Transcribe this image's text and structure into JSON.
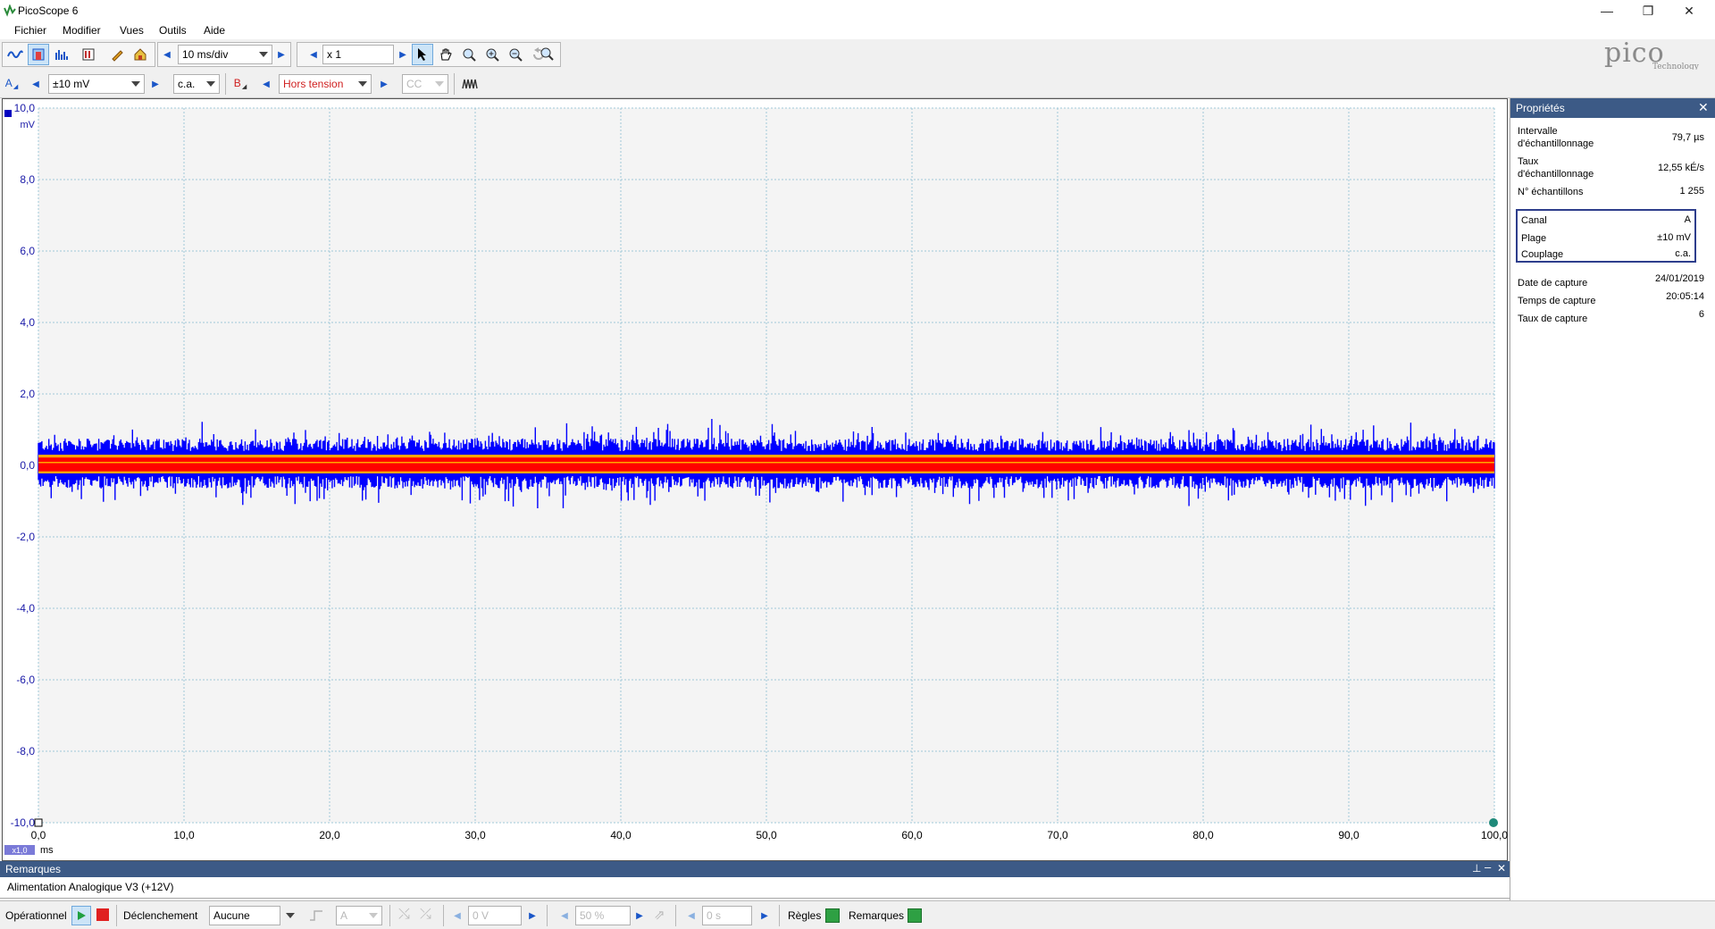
{
  "window": {
    "title": "PicoScope 6",
    "controls": [
      "—",
      "❐",
      "✕"
    ]
  },
  "menu": [
    "Fichier",
    "Modifier",
    "Vues",
    "Outils",
    "Aide"
  ],
  "toolbar1": {
    "timebase": "10 ms/div",
    "zoom_factor": "x 1"
  },
  "logo": {
    "name": "pico",
    "sub": "Technology"
  },
  "toolbar2": {
    "channel_a_label": "A",
    "channel_a_range": "±10 mV",
    "channel_a_coupling": "c.a.",
    "channel_b_label": "B",
    "channel_b_range": "Hors tension",
    "channel_b_coupling": "CC"
  },
  "scope": {
    "y_unit": "mV",
    "y_ticks": [
      "10,0",
      "8,0",
      "6,0",
      "4,0",
      "2,0",
      "0,0",
      "-2,0",
      "-4,0",
      "-6,0",
      "-8,0",
      "-10,0"
    ],
    "x_ticks": [
      "0,0",
      "10,0",
      "20,0",
      "30,0",
      "40,0",
      "50,0",
      "60,0",
      "70,0",
      "80,0",
      "90,0",
      "100,0"
    ],
    "x_unit": "ms",
    "x_zoom": "x1,0",
    "colors": {
      "trace": "#0000ff",
      "persistence_hot": "#ff0000",
      "persistence_warm": "#ffa500",
      "grid": "#a0c8d8",
      "background": "#f4f4f4"
    }
  },
  "chart_data": {
    "type": "line",
    "title": "",
    "xlabel": "ms",
    "ylabel": "mV",
    "xlim": [
      0,
      100
    ],
    "ylim": [
      -10,
      10
    ],
    "grid": true,
    "series": [
      {
        "name": "A",
        "description_values": {
          "mean": 0.0,
          "upper_band": 0.4,
          "lower_band": -0.3,
          "max_peak": 1.3,
          "min_peak": -1.2
        }
      }
    ]
  },
  "properties": {
    "title": "Propriétés",
    "rows": [
      {
        "label1": "Intervalle",
        "label2": "d'échantillonnage",
        "value": "79,7 µs"
      },
      {
        "label1": "Taux",
        "label2": "d'échantillonnage",
        "value": "12,55 kÉ/s"
      },
      {
        "label1": "N° échantillons",
        "label2": "",
        "value": "1 255"
      }
    ],
    "channel_box": [
      {
        "label": "Canal",
        "value": "A"
      },
      {
        "label": "Plage",
        "value": "±10 mV"
      },
      {
        "label": "Couplage",
        "value": "c.a."
      }
    ],
    "capture": [
      {
        "label": "Date de capture",
        "value": "24/01/2019"
      },
      {
        "label": "Temps de capture",
        "value": "20:05:14"
      },
      {
        "label": "Taux de capture",
        "value": "6"
      }
    ]
  },
  "remarques": {
    "title": "Remarques",
    "text": "Alimentation Analogique V3 (+12V)"
  },
  "statusbar": {
    "mode": "Opérationnel",
    "trigger_label": "Déclenchement",
    "trigger_value": "Aucune",
    "trigger_source": "A",
    "threshold": "0 V",
    "pretrigger": "50 %",
    "delay": "0 s",
    "rules": "Règles",
    "notes": "Remarques"
  }
}
